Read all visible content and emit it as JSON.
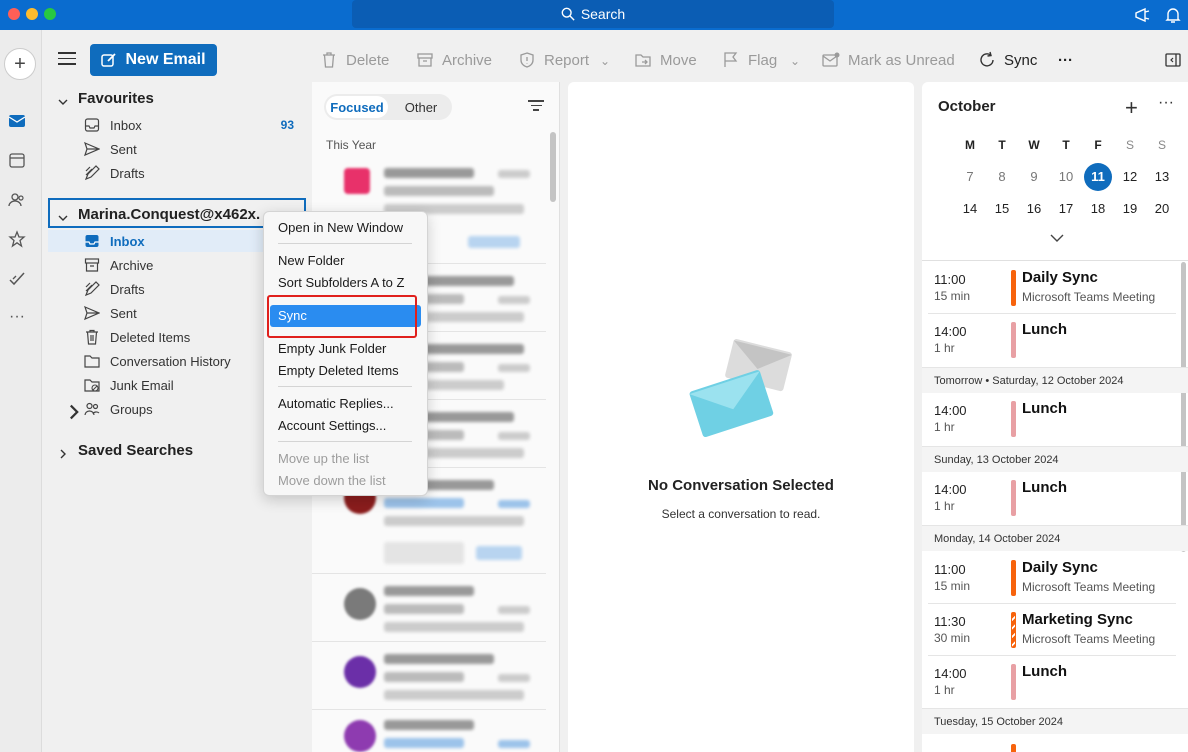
{
  "titlebar": {
    "search_label": "Search"
  },
  "toolbar": {
    "new_email": "New Email",
    "delete": "Delete",
    "archive": "Archive",
    "report": "Report",
    "move": "Move",
    "flag": "Flag",
    "mark_unread": "Mark as Unread",
    "sync": "Sync",
    "more": "···"
  },
  "favourites": {
    "title": "Favourites",
    "items": [
      {
        "label": "Inbox",
        "count": "93",
        "icon": "inbox-icon"
      },
      {
        "label": "Sent",
        "icon": "sent-icon"
      },
      {
        "label": "Drafts",
        "icon": "drafts-icon"
      }
    ]
  },
  "account": {
    "title": "Marina.Conquest@x462x.",
    "items": [
      {
        "label": "Inbox",
        "icon": "inbox-icon"
      },
      {
        "label": "Archive",
        "icon": "archive-icon"
      },
      {
        "label": "Drafts",
        "icon": "drafts-icon"
      },
      {
        "label": "Sent",
        "icon": "sent-icon"
      },
      {
        "label": "Deleted Items",
        "icon": "trash-icon"
      },
      {
        "label": "Conversation History",
        "icon": "folder-icon"
      },
      {
        "label": "Junk Email",
        "icon": "junk-icon"
      },
      {
        "label": "Groups",
        "icon": "groups-icon"
      }
    ]
  },
  "saved_searches": "Saved Searches",
  "message_list": {
    "tabs": [
      "Focused",
      "Other"
    ],
    "year_label": "This Year"
  },
  "reading_pane": {
    "title": "No Conversation Selected",
    "subtitle": "Select a conversation to read."
  },
  "context_menu": {
    "items": [
      "Open in New Window",
      "New Folder",
      "Sort Subfolders A to Z",
      "Sync",
      "Empty Junk Folder",
      "Empty Deleted Items",
      "Automatic Replies...",
      "Account Settings...",
      "Move up the list",
      "Move down the list"
    ]
  },
  "calendar": {
    "month": "October",
    "weekdays": [
      "M",
      "T",
      "W",
      "T",
      "F",
      "S",
      "S"
    ],
    "week1": [
      "7",
      "8",
      "9",
      "10",
      "11",
      "12",
      "13"
    ],
    "week2": [
      "14",
      "15",
      "16",
      "17",
      "18",
      "19",
      "20"
    ],
    "today": "11",
    "events_today": [
      {
        "time": "11:00",
        "duration": "15 min",
        "title": "Daily Sync",
        "subtitle": "Microsoft Teams Meeting",
        "color": "#f7630c"
      },
      {
        "time": "14:00",
        "duration": "1 hr",
        "title": "Lunch",
        "subtitle": "",
        "color": "#e8a0a4"
      }
    ],
    "day_tomorrow": "Tomorrow • Saturday, 12 October 2024",
    "events_tomorrow": [
      {
        "time": "14:00",
        "duration": "1 hr",
        "title": "Lunch",
        "color": "#e8a0a4"
      }
    ],
    "day_sunday": "Sunday, 13 October 2024",
    "events_sunday": [
      {
        "time": "14:00",
        "duration": "1 hr",
        "title": "Lunch",
        "color": "#e8a0a4"
      }
    ],
    "day_monday": "Monday, 14 October 2024",
    "events_monday": [
      {
        "time": "11:00",
        "duration": "15 min",
        "title": "Daily Sync",
        "subtitle": "Microsoft Teams Meeting",
        "color": "#f7630c"
      },
      {
        "time": "11:30",
        "duration": "30 min",
        "title": "Marketing Sync",
        "subtitle": "Microsoft Teams Meeting",
        "color": "#f7630c"
      },
      {
        "time": "14:00",
        "duration": "1 hr",
        "title": "Lunch",
        "color": "#e8a0a4"
      }
    ],
    "day_tuesday": "Tuesday, 15 October 2024"
  }
}
